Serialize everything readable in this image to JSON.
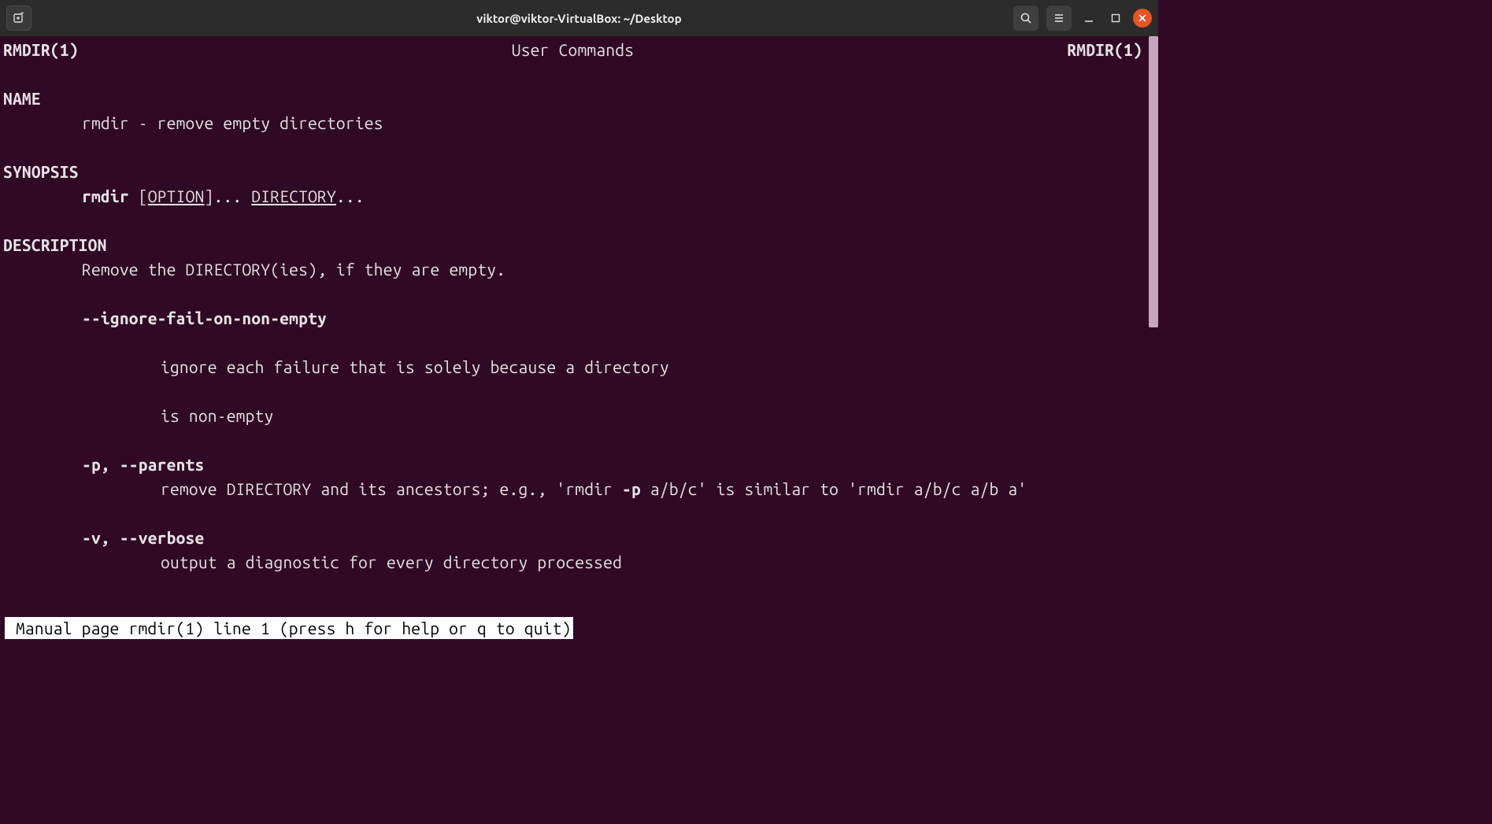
{
  "window": {
    "title": "viktor@viktor-VirtualBox: ~/Desktop"
  },
  "man": {
    "header_left": "RMDIR(1)",
    "header_center": "User Commands",
    "header_right": "RMDIR(1)",
    "name_head": "NAME",
    "name_line": "rmdir - remove empty directories",
    "synopsis_head": "SYNOPSIS",
    "syn_cmd": "rmdir",
    "syn_open": " [",
    "syn_option": "OPTION",
    "syn_mid": "]... ",
    "syn_dir": "DIRECTORY",
    "syn_end": "...",
    "description_head": "DESCRIPTION",
    "desc_line": "Remove the DIRECTORY(ies), if they are empty.",
    "opt1": "--ignore-fail-on-non-empty",
    "opt1_desc1": "ignore each failure that is solely because a directory",
    "opt1_desc2": "is non-empty",
    "opt2": "-p, --parents",
    "opt2_desc_pre": "remove  DIRECTORY  and  its  ancestors; e.g., 'rmdir ",
    "opt2_flag": "-p",
    "opt2_desc_post": " a/b/c' is similar to 'rmdir a/b/c a/b a'",
    "opt3": "-v, --verbose",
    "opt3_desc": "output a diagnostic for every directory processed"
  },
  "status": " Manual page rmdir(1) line 1 (press h for help or q to quit)"
}
